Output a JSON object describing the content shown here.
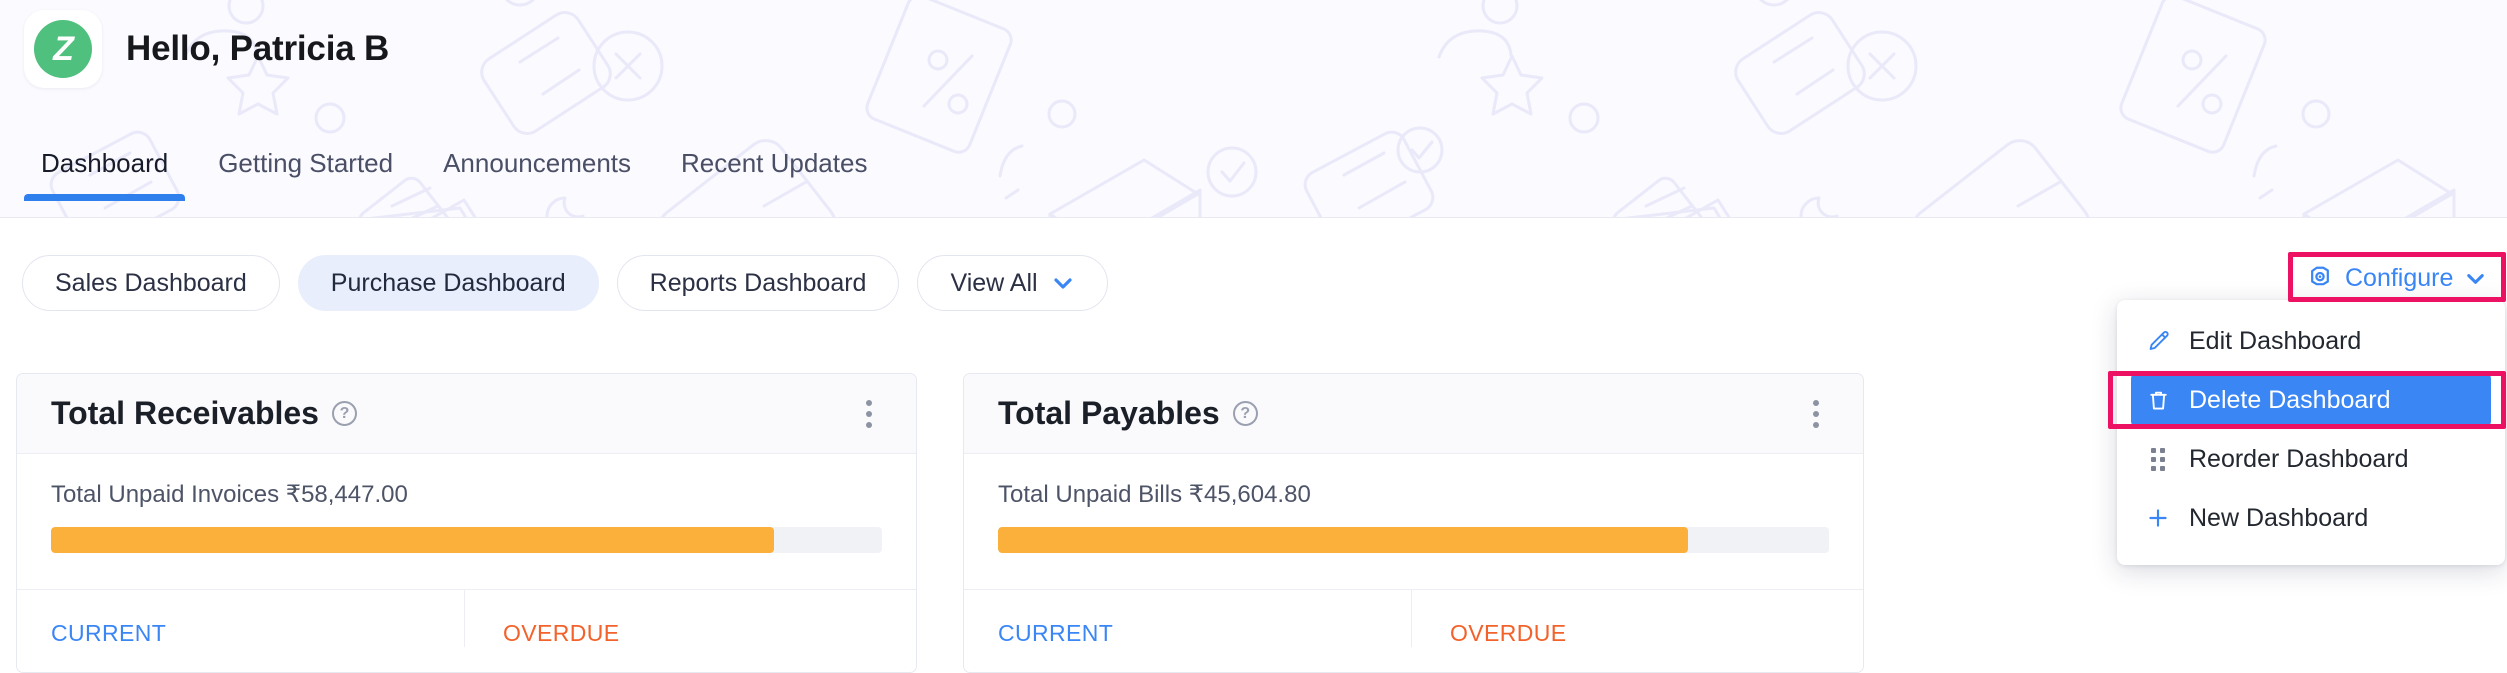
{
  "header": {
    "logo_letter": "Z",
    "logo_icon": "zoho-logo-icon",
    "greeting": "Hello, Patricia B",
    "brand_color": "#4fc07d",
    "background_color": "#fafaff"
  },
  "tabs": [
    {
      "label": "Dashboard",
      "active": true
    },
    {
      "label": "Getting Started",
      "active": false
    },
    {
      "label": "Announcements",
      "active": false
    },
    {
      "label": "Recent Updates",
      "active": false
    }
  ],
  "accent_color": "#2f80ed",
  "dashboard_pills": [
    {
      "label": "Sales Dashboard",
      "selected": false
    },
    {
      "label": "Purchase Dashboard",
      "selected": true
    },
    {
      "label": "Reports Dashboard",
      "selected": false
    },
    {
      "label": "View All",
      "selected": false,
      "has_chevron": true
    }
  ],
  "configure": {
    "label": "Configure",
    "icon": "gear-icon",
    "chevron": "chevron-down-icon",
    "color": "#3a86f5",
    "highlight_color": "#ed1164"
  },
  "configure_menu": [
    {
      "label": "Edit Dashboard",
      "icon": "pencil-icon",
      "active": false
    },
    {
      "label": "Delete Dashboard",
      "icon": "trash-icon",
      "active": true
    },
    {
      "label": "Reorder Dashboard",
      "icon": "dot-grid-icon",
      "active": false
    },
    {
      "label": "New Dashboard",
      "icon": "plus-icon",
      "active": false
    }
  ],
  "cards": [
    {
      "title": "Total Receivables",
      "help_icon": "help-circle-icon",
      "menu_icon": "kebab-menu-icon",
      "body_label": "Total Unpaid Invoices ₹58,447.00",
      "bar_color": "#fbb03b",
      "bar_percent": "87%",
      "footer": [
        {
          "label": "CURRENT",
          "tone": "current"
        },
        {
          "label": "OVERDUE",
          "tone": "overdue"
        }
      ]
    },
    {
      "title": "Total Payables",
      "help_icon": "help-circle-icon",
      "menu_icon": "kebab-menu-icon",
      "body_label": "Total Unpaid Bills ₹45,604.80",
      "bar_color": "#fbb03b",
      "bar_percent": "83%",
      "footer": [
        {
          "label": "CURRENT",
          "tone": "current"
        },
        {
          "label": "OVERDUE",
          "tone": "overdue"
        }
      ]
    }
  ]
}
